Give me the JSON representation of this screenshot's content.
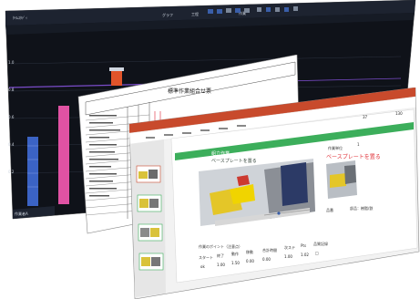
{
  "dark_app": {
    "title": "ﾀｲﾑｽﾀﾃﾞｨ",
    "tab_left": "グラフ",
    "tab_mid": "工程",
    "tab_right": "作業",
    "bottom_label": "作業者A",
    "colors": {
      "bg": "#0f1219",
      "bar_blue": "#3b63c4",
      "bar_pink": "#e052a3",
      "bar_orange": "#e0542a",
      "accent_line": "#7a4cc9"
    }
  },
  "form_sheet": {
    "title": "標準作業組合せ票",
    "colors": {
      "line": "#222222",
      "paper": "#ffffff"
    }
  },
  "presentation": {
    "header_num_left": "37",
    "header_num_right": "130",
    "slide_title": "組立作業",
    "step_title": "ベースプレートを置る",
    "right_label_top": "作業単位",
    "right_label_top2": "1",
    "right_red_title": "ベースプレートを置る",
    "point_label": "作業のポイント（注意点）",
    "right_note": "品番",
    "right_note2": "部品：樹脂/鉄",
    "metrics": {
      "labels": [
        "スタート",
        "終了",
        "動作",
        "移動",
        "合計時間",
        "次ステ",
        "Pts",
        "品質記録"
      ],
      "values": [
        "ok",
        "1.00",
        "1.50",
        "0.00",
        "0.00",
        "1.00",
        "1.02",
        "□"
      ]
    },
    "colors": {
      "accent": "#3cae5b",
      "red": "#e0333a",
      "title_bar": "#c84a2c"
    }
  }
}
